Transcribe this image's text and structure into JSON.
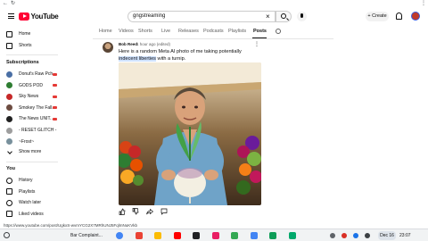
{
  "browser": {
    "back_glyph": "←",
    "refresh_glyph": "↻",
    "ext_glyph": "⋮"
  },
  "topbar": {
    "logo_text": "YouTube",
    "search_query": "gngstreaming",
    "create_label": "+ Create"
  },
  "sidebar": {
    "nav": [
      {
        "label": "Home",
        "icon": "home-icon"
      },
      {
        "label": "Shorts",
        "icon": "shorts-icon"
      }
    ],
    "subscriptions_heading": "Subscriptions",
    "subscriptions": [
      {
        "label": "Donut's Raw Pch...",
        "color": "#4a6fa5",
        "live": true
      },
      {
        "label": "GODS POD",
        "color": "#2e7d32",
        "live": true
      },
      {
        "label": "Sky News",
        "color": "#c62828",
        "live": true
      },
      {
        "label": "Smokey The Fall...",
        "color": "#6d4c41",
        "live": true
      },
      {
        "label": "The News UNIT...",
        "color": "#212121",
        "live": true
      },
      {
        "label": "- RESET GLITCH -",
        "color": "#9e9e9e",
        "live": false
      },
      {
        "label": "~Frost~",
        "color": "#78909c",
        "live": false
      }
    ],
    "show_more_label": "Show more",
    "you_heading": "You",
    "you_items": [
      {
        "label": "History",
        "icon": "history-icon"
      },
      {
        "label": "Playlists",
        "icon": "playlists-icon"
      },
      {
        "label": "Watch later",
        "icon": "watch-later-icon"
      },
      {
        "label": "Liked videos",
        "icon": "liked-videos-icon"
      }
    ]
  },
  "tabs": {
    "items": [
      "Home",
      "Videos",
      "Shorts",
      "Live",
      "Releases",
      "Podcasts",
      "Playlists",
      "Posts"
    ],
    "active": "Posts"
  },
  "post": {
    "author": "Bob Reed",
    "time": "1 hour ago (edited)",
    "text_before": "Here is a random Meta AI photo of me taking  potentially ",
    "text_highlight": "indecent liberties",
    "text_after": " with a turnip.",
    "menu_glyph": "⋮",
    "photo_alt_icon": "ai-generated-photo"
  },
  "status_url": "https://www.youtube.com/post/UgkxS-wvmYCG2X7MRhUNJ5FqlmNuKVkb",
  "taskbar": {
    "window_title": "Bar Complaint...",
    "date": "Dec 16",
    "time": "23:07",
    "apps": [
      {
        "icon": "chrome-icon",
        "color": "#4285f4"
      },
      {
        "icon": "gmail-icon",
        "color": "#ea4335"
      },
      {
        "icon": "files-icon",
        "color": "#fbbc04"
      },
      {
        "icon": "youtube-icon",
        "color": "#ff0000"
      },
      {
        "icon": "terminal-icon",
        "color": "#202124"
      },
      {
        "icon": "music-icon",
        "color": "#e91e63"
      },
      {
        "icon": "photos-icon",
        "color": "#34a853"
      },
      {
        "icon": "docs-icon",
        "color": "#4285f4"
      },
      {
        "icon": "sheets-icon",
        "color": "#0f9d58"
      },
      {
        "icon": "play-store-icon",
        "color": "#00a86b"
      }
    ]
  }
}
